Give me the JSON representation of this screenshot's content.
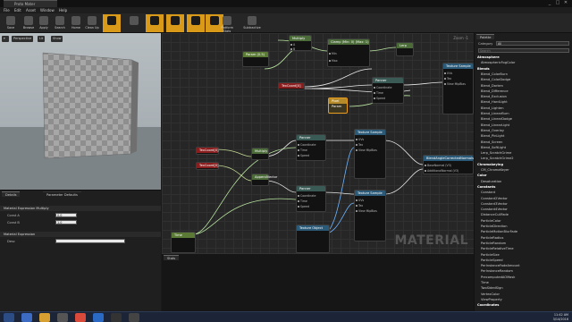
{
  "window": {
    "tab_title": "Proto Mater",
    "min": "_",
    "max": "□",
    "close": "✕"
  },
  "menu": [
    "File",
    "Edit",
    "Asset",
    "Window",
    "Help"
  ],
  "toolbar": [
    {
      "label": "Save",
      "hot": false
    },
    {
      "label": "Browse",
      "hot": false
    },
    {
      "label": "Apply",
      "hot": false
    },
    {
      "label": "Search",
      "hot": false
    },
    {
      "label": "Home",
      "hot": false
    },
    {
      "label": "Clean Up",
      "hot": false
    },
    {
      "label": "",
      "hot": true
    },
    {
      "label": "",
      "hot": false
    },
    {
      "label": "",
      "hot": true
    },
    {
      "label": "",
      "hot": true
    },
    {
      "label": "",
      "hot": true
    },
    {
      "label": "",
      "hot": true
    },
    {
      "label": "Platform Stats",
      "hot": false
    },
    {
      "label": "Subtractive",
      "hot": false
    }
  ],
  "viewport": {
    "buttons": [
      "Perspective",
      "Lit",
      "Show"
    ]
  },
  "details": {
    "tabs": [
      "Details",
      "Parameter Defaults"
    ],
    "section1": "Material Expression Multiply",
    "props1": [
      {
        "name": "Const A",
        "value": "0.0"
      },
      {
        "name": "Const B",
        "value": "1.0"
      }
    ],
    "section2": "Material Expression",
    "props2": [
      {
        "name": "Desc",
        "value": ""
      }
    ]
  },
  "graph": {
    "zoom": "Zoom -1",
    "watermark": "MATERIAL",
    "nodes": {
      "time1": "Time",
      "panner_top": "Panner",
      "param_panner": "Pixel Param",
      "add_mid": "Add",
      "tex_top": "Texture Sample",
      "texcoord1": "TexCoord[0]",
      "texcoord2": "TexCoord[0]",
      "texcoord3": "TexCoord[0]",
      "texcoord4": "TexCoord[0]",
      "panner2": "Panner",
      "panner3": "Panner",
      "swizzle": "BlendAngleCorrectedNormals",
      "tex_mid": "Texture Sample",
      "tex_bot": "Texture Sample",
      "texobject": "Texture Object",
      "time_bottom": "Time",
      "multiply": "Multiply",
      "multiply2": "Multiply",
      "append": "AppendVector",
      "clamp": "Clamp (Min: 0) (Max: 1)",
      "lerp": "Lerp",
      "paramscale": "Param (0.5)",
      "scalar": "Param (0.5)"
    },
    "pins": {
      "uvs": "UVs",
      "tex": "Tex",
      "view_mip": "View MipBias",
      "coordinate": "Coordinate",
      "time": "Time",
      "speed": "Speed",
      "base_normal": "BaseNormal (V3)",
      "additional_normal": "AdditionalNormal (V3)",
      "result": "Result",
      "min": "Min",
      "max": "Max",
      "a": "A",
      "b": "B",
      "alpha": "Alpha",
      "x": "X",
      "y": "Y",
      "z": "Z",
      "w": "W"
    }
  },
  "stats_tab": "Stats",
  "palette": {
    "tab": "Palette",
    "category_label": "Category",
    "category_value": "All",
    "search_placeholder": "Search",
    "items": [
      {
        "text": "Atmosphere",
        "cat": true
      },
      {
        "text": "AtmosphericFogColor",
        "cat": false
      },
      {
        "text": "Blends",
        "cat": true
      },
      {
        "text": "Blend_ColorBurn",
        "cat": false
      },
      {
        "text": "Blend_ColorDodge",
        "cat": false
      },
      {
        "text": "Blend_Darken",
        "cat": false
      },
      {
        "text": "Blend_Difference",
        "cat": false
      },
      {
        "text": "Blend_Exclusion",
        "cat": false
      },
      {
        "text": "Blend_HardLight",
        "cat": false
      },
      {
        "text": "Blend_Lighten",
        "cat": false
      },
      {
        "text": "Blend_LinearBurn",
        "cat": false
      },
      {
        "text": "Blend_LinearDodge",
        "cat": false
      },
      {
        "text": "Blend_LinearLight",
        "cat": false
      },
      {
        "text": "Blend_Overlay",
        "cat": false
      },
      {
        "text": "Blend_PinLight",
        "cat": false
      },
      {
        "text": "Blend_Screen",
        "cat": false
      },
      {
        "text": "Blend_SoftLight",
        "cat": false
      },
      {
        "text": "Lerp_ScratchGrime",
        "cat": false
      },
      {
        "text": "Lerp_ScratchGrime2",
        "cat": false
      },
      {
        "text": "Chromakeying",
        "cat": true
      },
      {
        "text": "CM_ChromaKeyer",
        "cat": false
      },
      {
        "text": "Color",
        "cat": true
      },
      {
        "text": "Desaturation",
        "cat": false
      },
      {
        "text": "Constants",
        "cat": true
      },
      {
        "text": "Constant",
        "cat": false
      },
      {
        "text": "Constant2Vector",
        "cat": false
      },
      {
        "text": "Constant3Vector",
        "cat": false
      },
      {
        "text": "Constant4Vector",
        "cat": false
      },
      {
        "text": "DistanceCullFade",
        "cat": false
      },
      {
        "text": "ParticleColor",
        "cat": false
      },
      {
        "text": "ParticleDirection",
        "cat": false
      },
      {
        "text": "ParticleMotionBlurFade",
        "cat": false
      },
      {
        "text": "ParticleRadius",
        "cat": false
      },
      {
        "text": "ParticleRandom",
        "cat": false
      },
      {
        "text": "ParticleRelativeTime",
        "cat": false
      },
      {
        "text": "ParticleSize",
        "cat": false
      },
      {
        "text": "ParticleSpeed",
        "cat": false
      },
      {
        "text": "PerInstanceFadeAmount",
        "cat": false
      },
      {
        "text": "PerInstanceRandom",
        "cat": false
      },
      {
        "text": "PrecomputedAOMask",
        "cat": false
      },
      {
        "text": "Time",
        "cat": false
      },
      {
        "text": "TwoSidedSign",
        "cat": false
      },
      {
        "text": "VertexColor",
        "cat": false
      },
      {
        "text": "ViewProperty",
        "cat": false
      },
      {
        "text": "Coordinates",
        "cat": true
      }
    ]
  },
  "clock": {
    "time": "11:42 AM",
    "date": "3/14/2016"
  }
}
